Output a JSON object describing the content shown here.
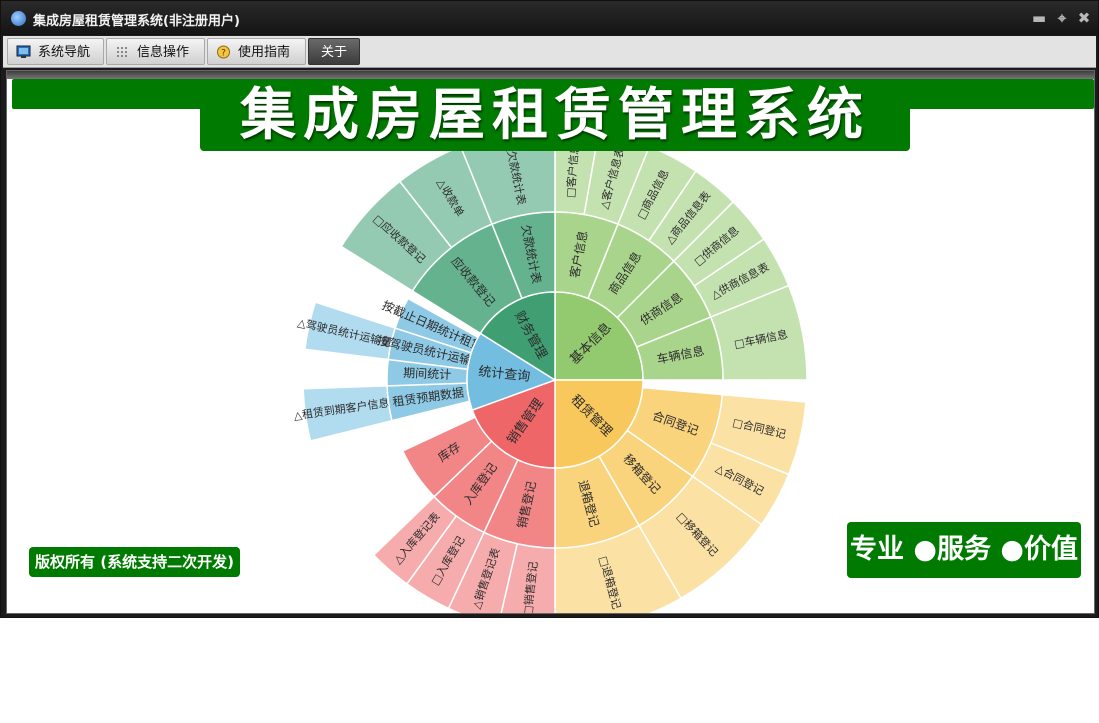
{
  "window": {
    "title": "集成房屋租赁管理系统(非注册用户)",
    "controls": [
      "minimize-icon",
      "restore-icon",
      "close-icon"
    ]
  },
  "menu": {
    "tabs": [
      {
        "label": "系统导航",
        "icon": "monitor-icon"
      },
      {
        "label": "信息操作",
        "icon": "grid-icon"
      },
      {
        "label": "使用指南",
        "icon": "help-icon"
      },
      {
        "label": "关于",
        "icon": ""
      }
    ],
    "active_tab": "关于"
  },
  "banner": {
    "title": "集成房屋租赁管理系统"
  },
  "sunburst": {
    "inner": [
      {
        "label": "基本信息",
        "color": "#93c96f"
      },
      {
        "label": "租赁管理",
        "color": "#f9c85c"
      },
      {
        "label": "销售管理",
        "color": "#ef6668"
      },
      {
        "label": "统计查询",
        "color": "#72bde0"
      },
      {
        "label": "财务管理",
        "color": "#3f9f73"
      }
    ],
    "middle": [
      {
        "label": "客户信息",
        "group": "基本信息"
      },
      {
        "label": "商品信息",
        "group": "基本信息"
      },
      {
        "label": "供商信息",
        "group": "基本信息"
      },
      {
        "label": "车辆信息",
        "group": "基本信息"
      },
      {
        "label": "合同登记",
        "group": "租赁管理"
      },
      {
        "label": "移箱登记",
        "group": "租赁管理"
      },
      {
        "label": "退箱登记",
        "group": "租赁管理"
      },
      {
        "label": "销售登记",
        "group": "销售管理"
      },
      {
        "label": "入库登记",
        "group": "销售管理"
      },
      {
        "label": "库存",
        "group": "销售管理"
      },
      {
        "label": "租赁预期数据",
        "group": "统计查询"
      },
      {
        "label": "期间统计",
        "group": "统计查询"
      },
      {
        "label": "按驾驶员统计运输量",
        "group": "统计查询"
      },
      {
        "label": "按截止日期统计租赁费",
        "group": "统计查询"
      },
      {
        "label": "应收款登记",
        "group": "财务管理"
      },
      {
        "label": "欠款统计表",
        "group": "财务管理"
      }
    ],
    "outer": [
      {
        "label": "□客户信息",
        "group": "客户信息"
      },
      {
        "label": "△客户信息表",
        "group": "客户信息"
      },
      {
        "label": "□商品信息",
        "group": "商品信息"
      },
      {
        "label": "△商品信息表",
        "group": "商品信息"
      },
      {
        "label": "□供商信息",
        "group": "供商信息"
      },
      {
        "label": "△供商信息表",
        "group": "供商信息"
      },
      {
        "label": "□车辆信息",
        "group": "车辆信息"
      },
      {
        "label": "□合同登记",
        "group": "合同登记"
      },
      {
        "label": "△合同登记",
        "group": "合同登记"
      },
      {
        "label": "□移箱登记",
        "group": "移箱登记"
      },
      {
        "label": "□退箱登记",
        "group": "退箱登记"
      },
      {
        "label": "□销售登记",
        "group": "销售登记"
      },
      {
        "label": "△销售登记表",
        "group": "销售登记"
      },
      {
        "label": "□入库登记",
        "group": "入库登记"
      },
      {
        "label": "△入库登记表",
        "group": "入库登记"
      },
      {
        "label": "△租赁到期客户信息表",
        "group": "租赁预期数据"
      },
      {
        "label": "△驾驶员统计运输量表",
        "group": "按驾驶员统计运输量"
      },
      {
        "label": "□应收款登记",
        "group": "应收款登记"
      },
      {
        "label": "△收款单",
        "group": "应收款登记"
      },
      {
        "label": "△欠款统计表",
        "group": "欠款统计表"
      }
    ]
  },
  "footer": {
    "copyright": "版权所有 (系统支持二次开发)",
    "slogan": "专业 ●服务 ●价值"
  },
  "colors": {
    "brand_green": "#007a00",
    "titlebar": "#1b1b1b"
  }
}
